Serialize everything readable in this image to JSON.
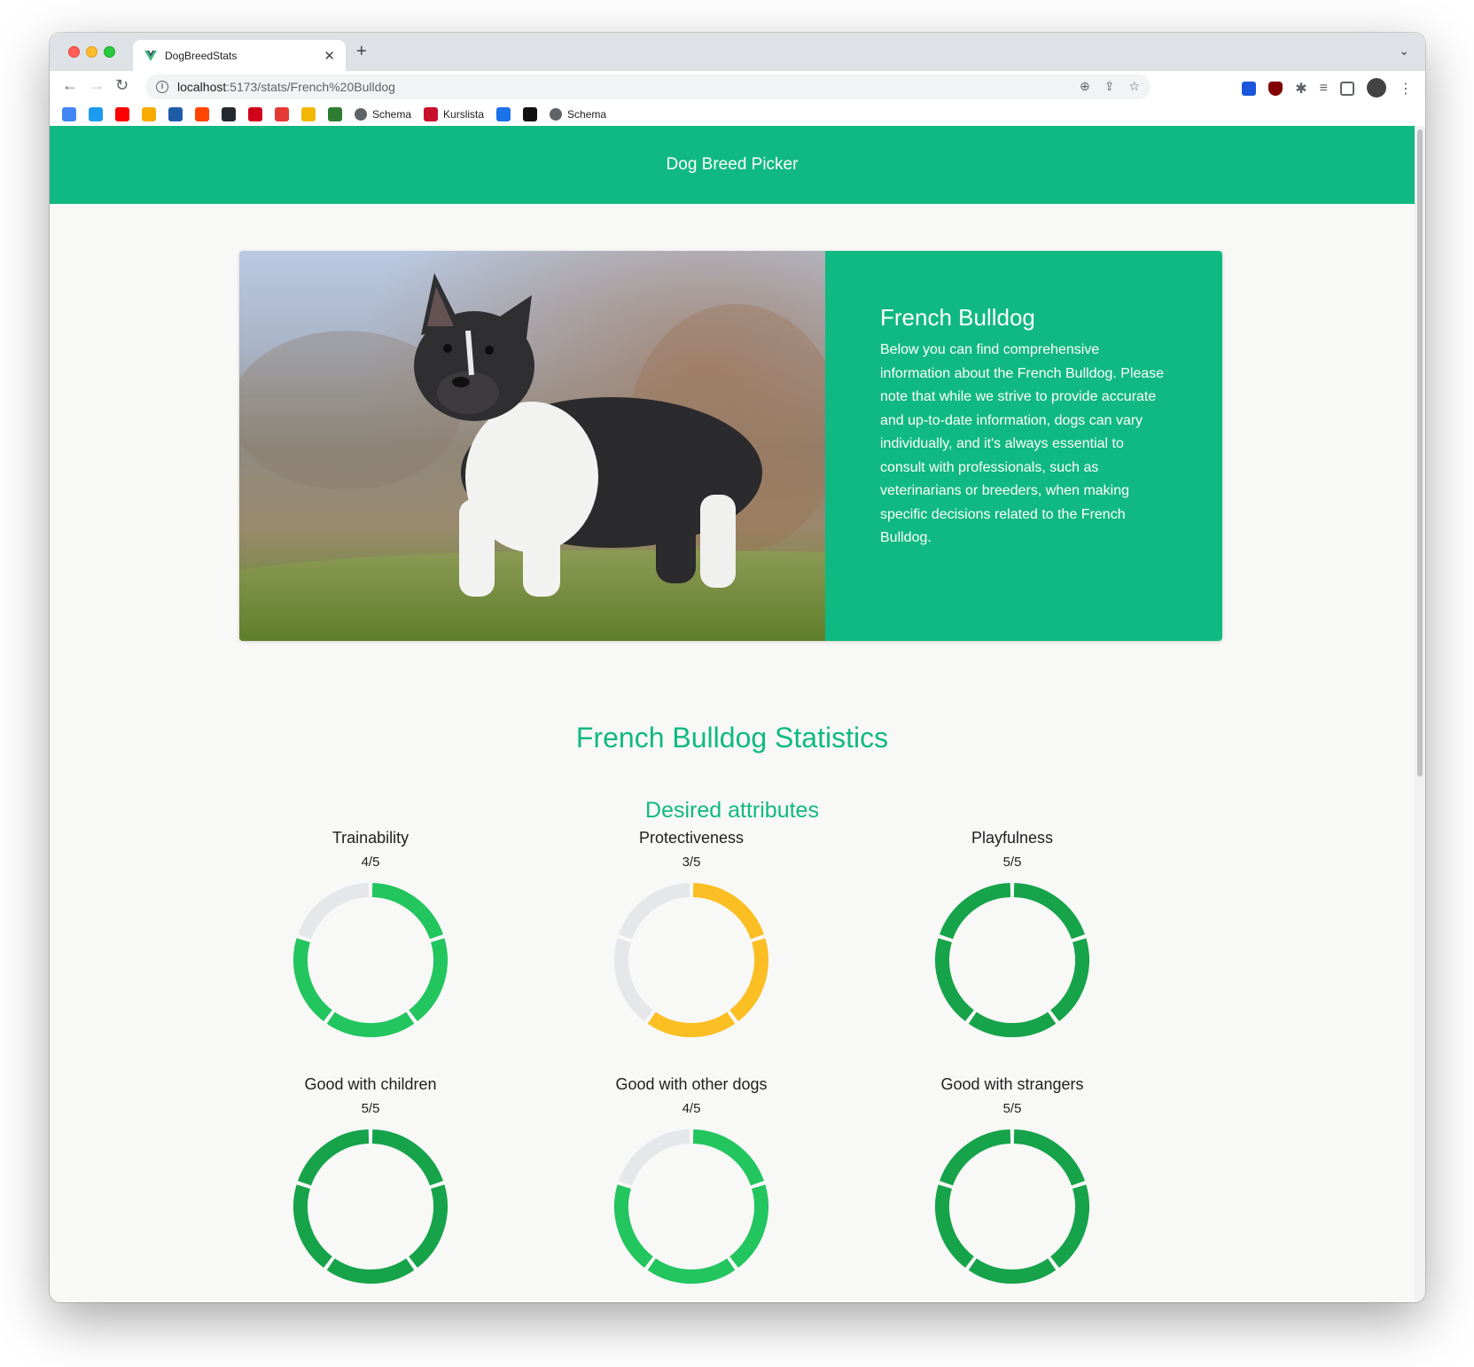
{
  "browser": {
    "tab_title": "DogBreedStats",
    "url_host": "localhost",
    "url_path": ":5173/stats/French%20Bulldog",
    "bookmarks": [
      {
        "icon": "google-icon",
        "color": "#4285f4"
      },
      {
        "icon": "twitter-icon",
        "color": "#1d9bf0"
      },
      {
        "icon": "youtube-icon",
        "color": "#ff0000"
      },
      {
        "icon": "analytics-icon",
        "color": "#f9ab00"
      },
      {
        "icon": "blue-square-icon",
        "color": "#1f5ca8"
      },
      {
        "icon": "reddit-icon",
        "color": "#ff4500"
      },
      {
        "icon": "github-icon",
        "color": "#24292f"
      },
      {
        "icon": "red-triangle-icon",
        "color": "#d0021b"
      },
      {
        "icon": "ring-icon",
        "color": "#e53935"
      },
      {
        "icon": "bee-icon",
        "color": "#f2b705"
      },
      {
        "icon": "green-l-icon",
        "color": "#2e7d32"
      },
      {
        "icon": "globe-icon",
        "label": "Schema"
      },
      {
        "icon": "kth-icon",
        "label": "Kurslista",
        "color": "#c8102e"
      },
      {
        "icon": "diamond-icon",
        "color": "#1a73e8"
      },
      {
        "icon": "ghost-icon",
        "color": "#111111"
      },
      {
        "icon": "globe-icon",
        "label": "Schema"
      }
    ]
  },
  "header": {
    "title": "Dog Breed Picker"
  },
  "breed_card": {
    "image_alt": "French Bulldog photo",
    "name": "French Bulldog",
    "description": "Below you can find comprehensive information about the French Bulldog. Please note that while we strive to provide accurate and up-to-date information, dogs can vary individually, and it's always essential to consult with professionals, such as veterinarians or breeders, when making specific decisions related to the French Bulldog."
  },
  "stats": {
    "title": "French Bulldog Statistics",
    "section_title": "Desired attributes",
    "colors": {
      "high": "#16a34a",
      "mid_high": "#22c55e",
      "mid": "#fbbf24",
      "empty": "#e5e7eb"
    },
    "items": [
      {
        "label": "Trainability",
        "score_text": "4/5",
        "score": 4,
        "max": 5
      },
      {
        "label": "Protectiveness",
        "score_text": "3/5",
        "score": 3,
        "max": 5
      },
      {
        "label": "Playfulness",
        "score_text": "5/5",
        "score": 5,
        "max": 5
      },
      {
        "label": "Good with children",
        "score_text": "5/5",
        "score": 5,
        "max": 5
      },
      {
        "label": "Good with other dogs",
        "score_text": "4/5",
        "score": 4,
        "max": 5
      },
      {
        "label": "Good with strangers",
        "score_text": "5/5",
        "score": 5,
        "max": 5
      }
    ]
  }
}
